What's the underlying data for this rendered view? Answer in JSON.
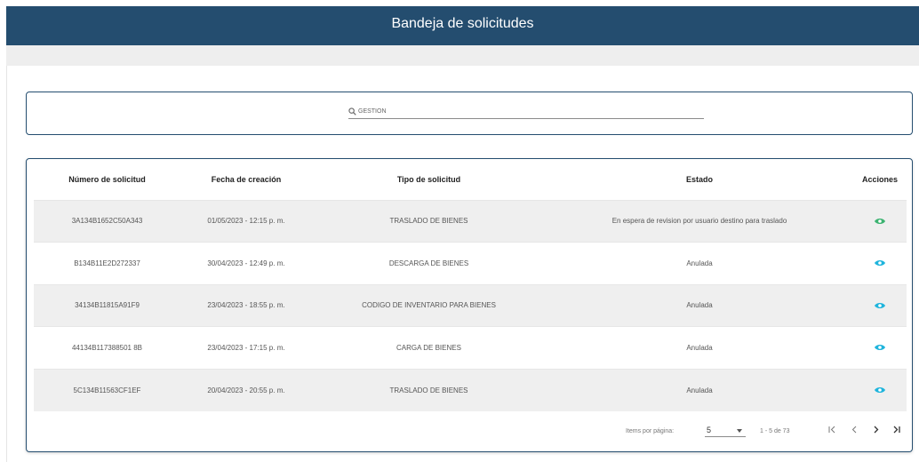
{
  "header": {
    "title": "Bandeja de solicitudes"
  },
  "search": {
    "placeholder": "GESTION",
    "value": ""
  },
  "table": {
    "columns": [
      "Número de solicitud",
      "Fecha de creación",
      "Tipo de solicitud",
      "Estado",
      "Acciones"
    ],
    "rows": [
      {
        "numero": "3A134B1652C50A343",
        "fecha": "01/05/2023 - 12:15 p. m.",
        "tipo": "TRASLADO DE BIENES",
        "estado": "En espera de revision por usuario destino para traslado",
        "icon_color": "#3cb371"
      },
      {
        "numero": "B134B11E2D272337",
        "fecha": "30/04/2023 - 12:49 p. m.",
        "tipo": "DESCARGA DE BIENES",
        "estado": "Anulada",
        "icon_color": "#1eb4dc"
      },
      {
        "numero": "34134B11815A91F9",
        "fecha": "23/04/2023 - 18:55 p. m.",
        "tipo": "CODIGO DE INVENTARIO PARA BIENES",
        "estado": "Anulada",
        "icon_color": "#1eb4dc"
      },
      {
        "numero": "44134B117388501 8B",
        "fecha": "23/04/2023 - 17:15 p. m.",
        "tipo": "CARGA DE BIENES",
        "estado": "Anulada",
        "icon_color": "#1eb4dc"
      },
      {
        "numero": "5C134B11563CF1EF",
        "fecha": "20/04/2023 - 20:55 p. m.",
        "tipo": "TRASLADO DE BIENES",
        "estado": "Anulada",
        "icon_color": "#1eb4dc"
      }
    ]
  },
  "paginator": {
    "items_label": "Items por página:",
    "page_size": "5",
    "range_label": "1 - 5 de 73",
    "first_icon": "first-page-icon",
    "prev_icon": "chevron-left-icon",
    "next_icon": "chevron-right-icon",
    "last_icon": "last-page-icon"
  },
  "colors": {
    "header_bg": "#244d6f",
    "view_active": "#3cb371",
    "view_default": "#1eb4dc"
  }
}
